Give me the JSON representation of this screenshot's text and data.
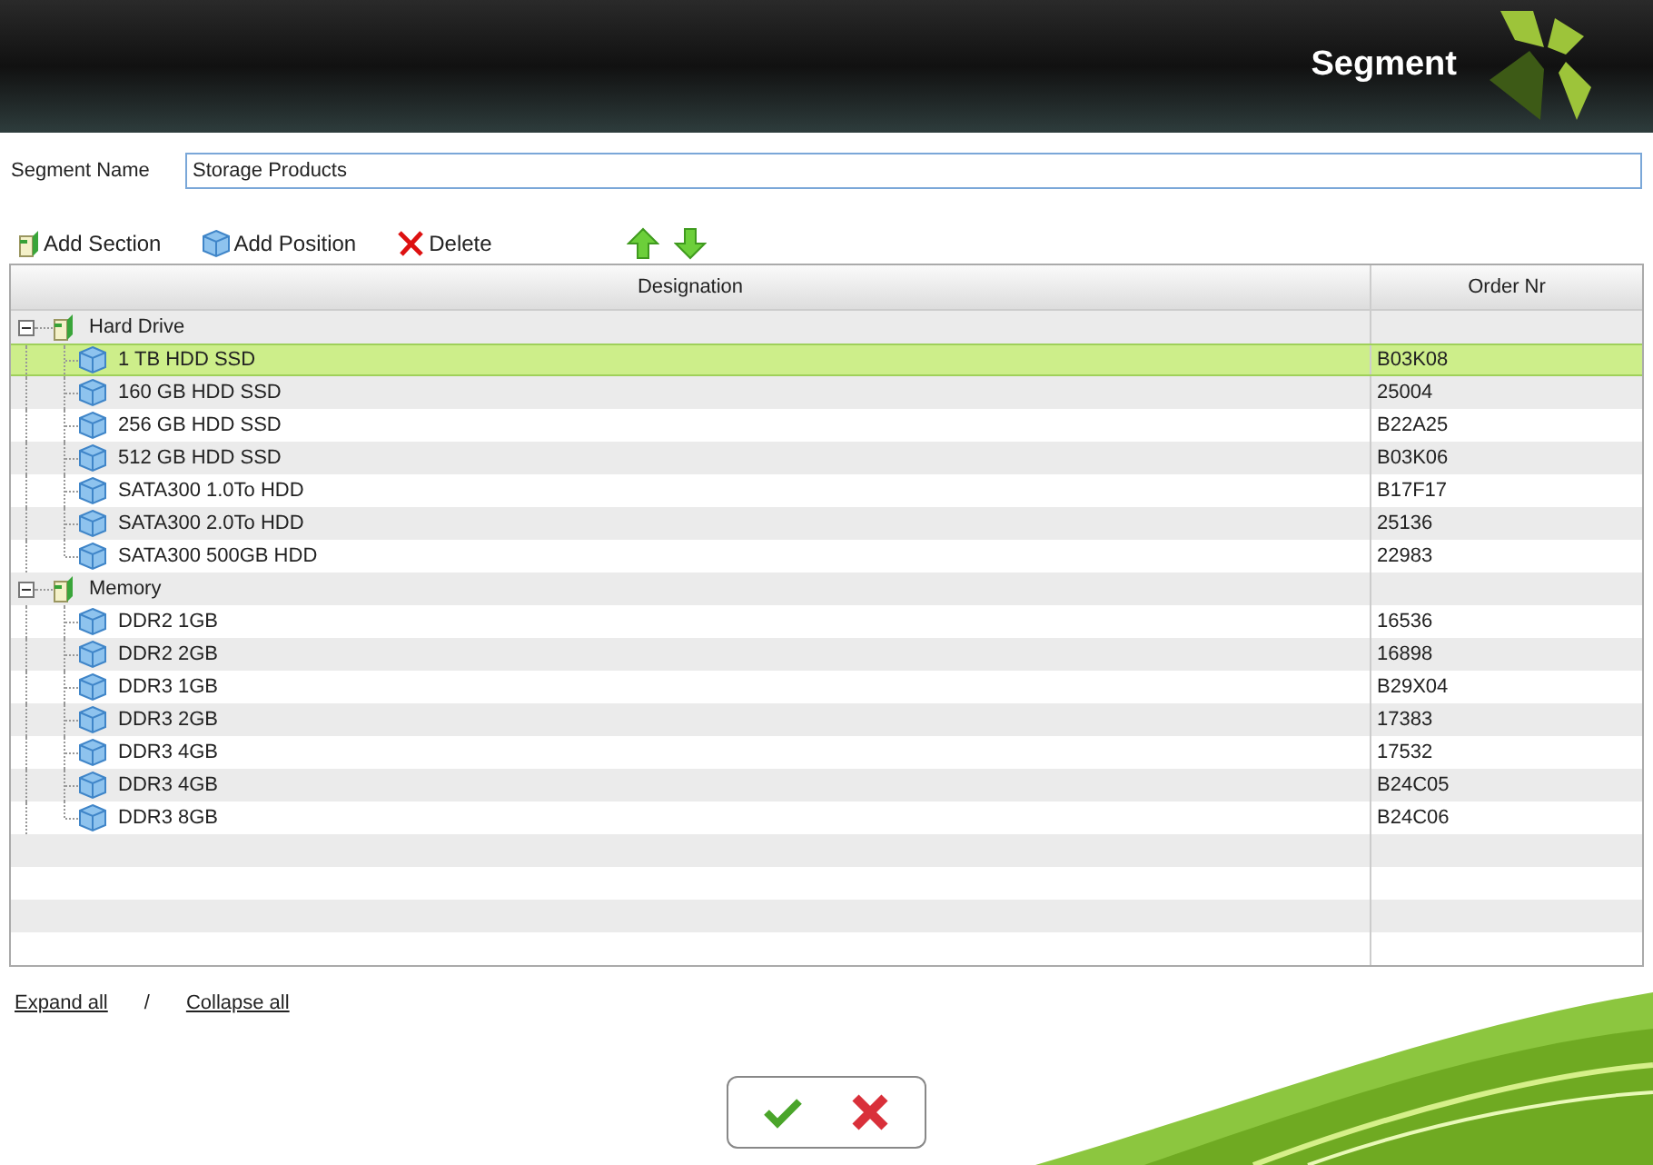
{
  "header": {
    "title": "Segment"
  },
  "segment_name": {
    "label": "Segment Name",
    "value": "Storage Products"
  },
  "toolbar": [
    {
      "kind": "section",
      "label": "Add Section"
    },
    {
      "kind": "position",
      "label": "Add Position"
    },
    {
      "kind": "delete",
      "label": "Delete"
    },
    {
      "kind": "up"
    },
    {
      "kind": "down"
    }
  ],
  "table": {
    "columns": [
      "Designation",
      "Order Nr"
    ],
    "rows": [
      {
        "label": "Hard Drive",
        "expanded": true,
        "selected": false,
        "children": [
          {
            "label": "1 TB HDD SSD",
            "order_nr": "B03K08",
            "selected": true
          },
          {
            "label": "160 GB HDD SSD",
            "order_nr": "25004",
            "selected": false
          },
          {
            "label": "256 GB HDD SSD",
            "order_nr": "B22A25",
            "selected": false
          },
          {
            "label": "512 GB HDD SSD",
            "order_nr": "B03K06",
            "selected": false
          },
          {
            "label": "SATA300 1.0To HDD",
            "order_nr": "B17F17",
            "selected": false
          },
          {
            "label": "SATA300 2.0To HDD",
            "order_nr": "25136",
            "selected": false
          },
          {
            "label": "SATA300 500GB HDD",
            "order_nr": "22983",
            "selected": false
          }
        ]
      },
      {
        "label": "Memory",
        "expanded": true,
        "selected": false,
        "children": [
          {
            "label": "DDR2 1GB",
            "order_nr": "16536",
            "selected": false
          },
          {
            "label": "DDR2 2GB",
            "order_nr": "16898",
            "selected": false
          },
          {
            "label": "DDR3 1GB",
            "order_nr": "B29X04",
            "selected": false
          },
          {
            "label": "DDR3 2GB",
            "order_nr": "17383",
            "selected": false
          },
          {
            "label": "DDR3 4GB",
            "order_nr": "17532",
            "selected": false
          },
          {
            "label": "DDR3 4GB",
            "order_nr": "B24C05",
            "selected": false
          },
          {
            "label": "DDR3 8GB",
            "order_nr": "B24C06",
            "selected": false
          }
        ]
      }
    ]
  },
  "footer": {
    "expand_all": "Expand all",
    "separator": "/",
    "collapse_all": "Collapse all"
  },
  "dialog_buttons": [
    {
      "kind": "ok"
    },
    {
      "kind": "cancel"
    }
  ]
}
